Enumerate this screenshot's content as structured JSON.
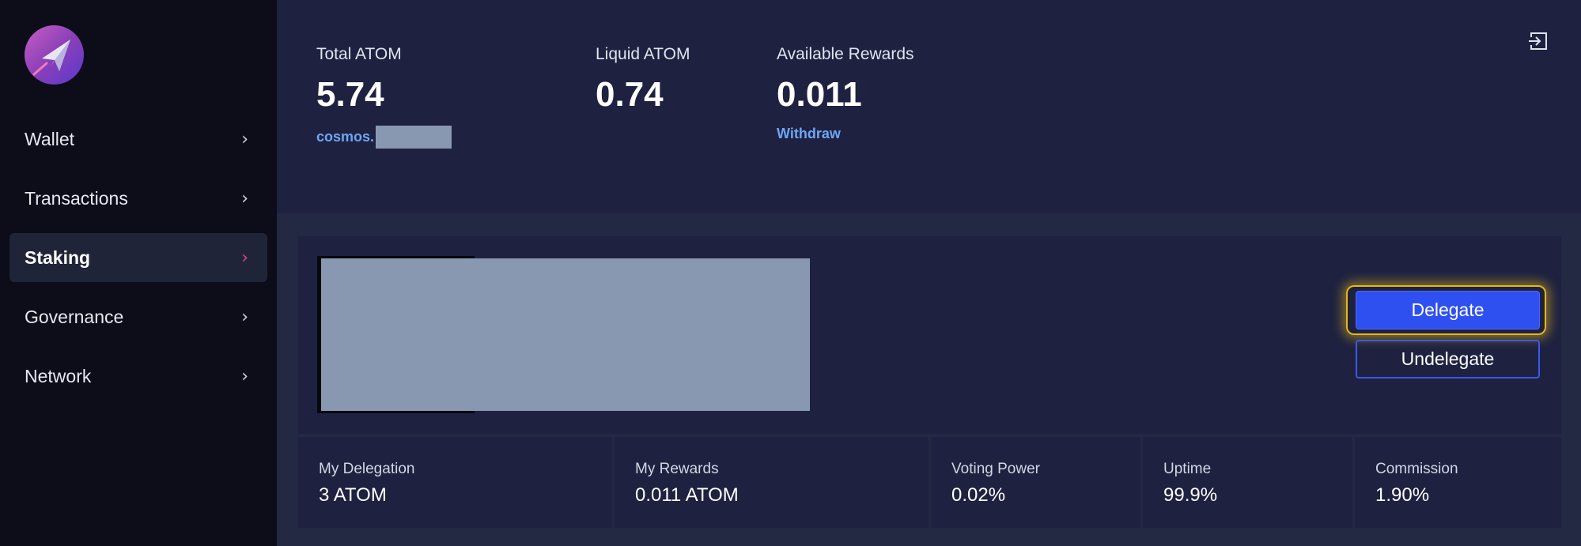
{
  "sidebar": {
    "items": [
      {
        "label": "Wallet",
        "chevron": "›"
      },
      {
        "label": "Transactions",
        "chevron": "›"
      },
      {
        "label": "Staking",
        "chevron": "›"
      },
      {
        "label": "Governance",
        "chevron": "›"
      },
      {
        "label": "Network",
        "chevron": "›"
      }
    ],
    "active": "Staking"
  },
  "header": {
    "total": {
      "title": "Total ATOM",
      "value": "5.74",
      "address_prefix": "cosmos."
    },
    "liquid": {
      "title": "Liquid ATOM",
      "value": "0.74"
    },
    "rewards": {
      "title": "Available Rewards",
      "value": "0.011",
      "link": "Withdraw"
    }
  },
  "actions": {
    "delegate": "Delegate",
    "undelegate": "Undelegate"
  },
  "stats": [
    {
      "title": "My Delegation",
      "value": "3 ATOM"
    },
    {
      "title": "My Rewards",
      "value": "0.011 ATOM"
    },
    {
      "title": "Voting Power",
      "value": "0.02%"
    },
    {
      "title": "Uptime",
      "value": "99.9%"
    },
    {
      "title": "Commission",
      "value": "1.90%"
    }
  ],
  "colors": {
    "sidebar_bg": "#0c0d18",
    "panel_bg": "#1e2240",
    "accent_blue": "#2f50f0",
    "link_blue": "#6fa5f5",
    "active_chevron": "#e0408a",
    "focus_glow": "#e8b616"
  },
  "icons": {
    "logo": "paper-plane-logo-icon",
    "exit": "sign-out-icon",
    "chevron": "chevron-right-icon"
  }
}
